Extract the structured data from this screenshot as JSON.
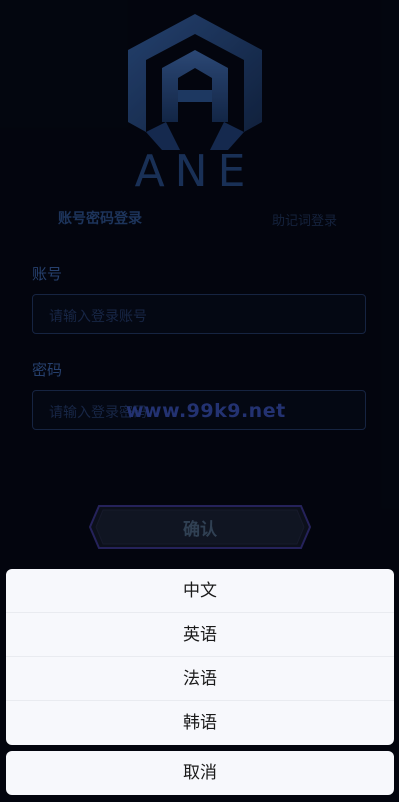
{
  "brand": {
    "name": "ANE"
  },
  "tabs": {
    "password_login": "账号密码登录",
    "mnemonic_login": "助记词登录"
  },
  "account": {
    "label": "账号",
    "placeholder": "请输入登录账号"
  },
  "password": {
    "label": "密码",
    "placeholder": "请输入登录密码"
  },
  "watermark": "www.99k9.net",
  "confirm_label": "确认",
  "language_sheet": {
    "options": [
      "中文",
      "英语",
      "法语",
      "韩语"
    ],
    "cancel_label": "取消"
  },
  "colors": {
    "background": "#040712",
    "logo_blue": "#1f3b69",
    "sheet_bg": "#f7f8fc"
  }
}
